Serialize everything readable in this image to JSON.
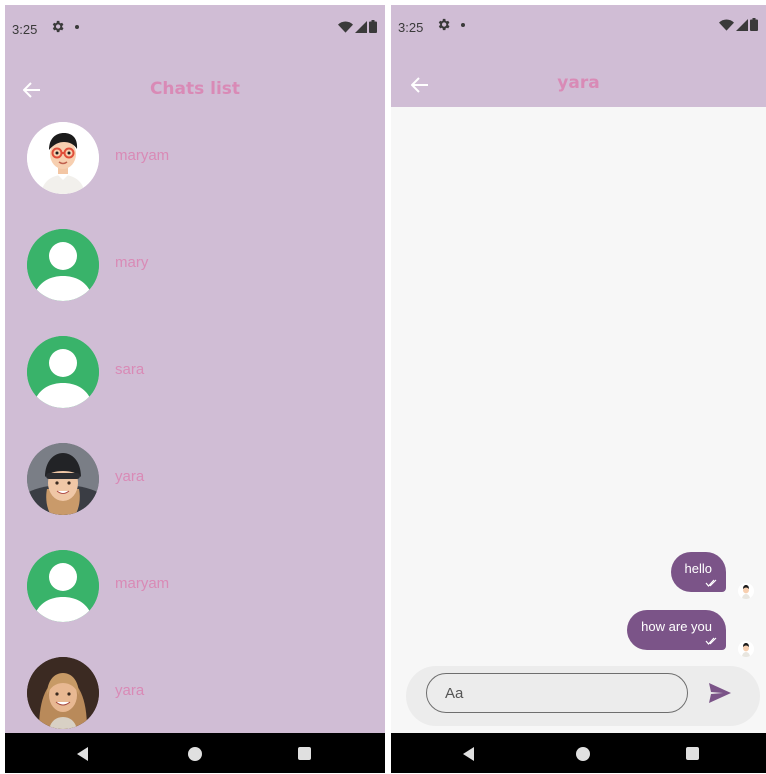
{
  "status_bar": {
    "time": "3:25"
  },
  "chats_screen": {
    "title": "Chats list",
    "chats": [
      {
        "name": "maryam",
        "avatar": "cartoon-boy-avatar"
      },
      {
        "name": "mary",
        "avatar": "default-person-avatar"
      },
      {
        "name": "sara",
        "avatar": "default-person-avatar"
      },
      {
        "name": "yara",
        "avatar": "photo-woman-beanie"
      },
      {
        "name": "maryam",
        "avatar": "default-person-avatar"
      },
      {
        "name": "yara",
        "avatar": "photo-woman-smiling"
      }
    ]
  },
  "chat_screen": {
    "title": "yara",
    "messages": [
      {
        "text": "hello",
        "status": "read"
      },
      {
        "text": "how are you",
        "status": "read"
      }
    ],
    "input_placeholder": "Aa"
  },
  "colors": {
    "app_bar": "#d0bdd5",
    "title_text": "#d98ab6",
    "bubble": "#7b5488",
    "default_avatar": "#39b36a",
    "nav_bar": "#000000"
  }
}
